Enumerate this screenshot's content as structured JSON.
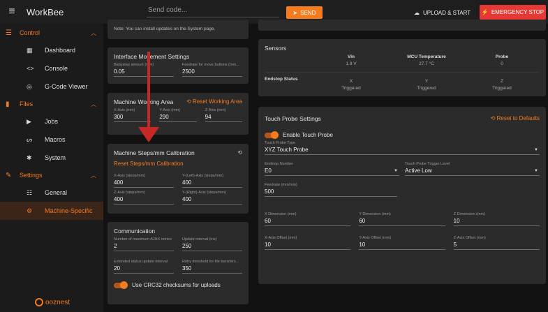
{
  "topbar": {
    "title": "WorkBee",
    "send_placeholder": "Send code...",
    "send_label": "SEND",
    "upload_label": "UPLOAD & START",
    "estop_label": "EMERGENCY STOP"
  },
  "sidebar": {
    "control": "Control",
    "files": "Files",
    "settings": "Settings",
    "items": {
      "dashboard": "Dashboard",
      "console": "Console",
      "gcode": "G-Code Viewer",
      "jobs": "Jobs",
      "macros": "Macros",
      "system": "System",
      "general": "General",
      "machine": "Machine-Specific"
    },
    "logo": "ooznest"
  },
  "note": "Note: You can install updates on the System page.",
  "interface": {
    "title": "Interface Movement Settings",
    "babystep_label": "Babystep amount (mm)",
    "babystep": "0.05",
    "feedrate_label": "Feedrate for move buttons (mm...",
    "feedrate": "2500"
  },
  "working": {
    "title": "Machine Working Area",
    "reset": "Reset Working Area",
    "x_label": "X-Axis (mm)",
    "x": "300",
    "y_label": "Y-Axis (mm)",
    "y": "290",
    "z_label": "Z-Axis (mm)",
    "z": "94"
  },
  "steps": {
    "title": "Machine Steps/mm Calibration",
    "reset": "Reset Steps/mm Calibration",
    "x_label": "X-Axis (steps/mm)",
    "x": "400",
    "yl_label": "Y-(Left)-Axis (steps/mm)",
    "yl": "400",
    "z_label": "Z-Axis (steps/mm)",
    "z": "400",
    "yr_label": "Y-(Right)-Axis (steps/mm)",
    "yr": "400"
  },
  "comm": {
    "title": "Communication",
    "retries_label": "Number of maximum AJAX retries",
    "retries": "2",
    "interval_label": "Update interval (ms)",
    "interval": "250",
    "ext_label": "Extended status update interval",
    "ext": "20",
    "retry_label": "Retry threshold for file transfers...",
    "retry": "350",
    "crc_label": "Use CRC32 checksums for uploads"
  },
  "sensors": {
    "title": "Sensors",
    "vin_label": "Vin",
    "vin": "1.8 V",
    "mcu_label": "MCU Temperature",
    "mcu": "27.7 °C",
    "probe_label": "Probe",
    "probe": "0",
    "endstop_label": "Endstop Status",
    "x_label": "X",
    "y_label": "Y",
    "z_label": "Z",
    "x": "Triggered",
    "y": "Triggered",
    "z": "Triggered"
  },
  "probe": {
    "title": "Touch Probe Settings",
    "reset": "Reset to Defaults",
    "enable_label": "Enable Touch Probe",
    "type_label": "Touch Probe Type",
    "type": "XYZ Touch Probe",
    "endstop_label": "Endstop Number",
    "endstop": "E0",
    "trigger_label": "Touch Probe Trigger Level",
    "trigger": "Active Low",
    "feed_label": "Feedrate (mm/min)",
    "feed": "500",
    "xd_label": "X Dimension (mm)",
    "xd": "60",
    "yd_label": "Y Dimension (mm)",
    "yd": "60",
    "zd_label": "Z Dimension (mm)",
    "zd": "10",
    "xo_label": "X-Axis Offset (mm)",
    "xo": "10",
    "yo_label": "Y-Axis Offset (mm)",
    "yo": "10",
    "zo_label": "Z-Axis Offset (mm)",
    "zo": "5"
  },
  "colors": {
    "accent": "#f47b20",
    "estop": "#e53935",
    "arrow": "#c62828"
  }
}
